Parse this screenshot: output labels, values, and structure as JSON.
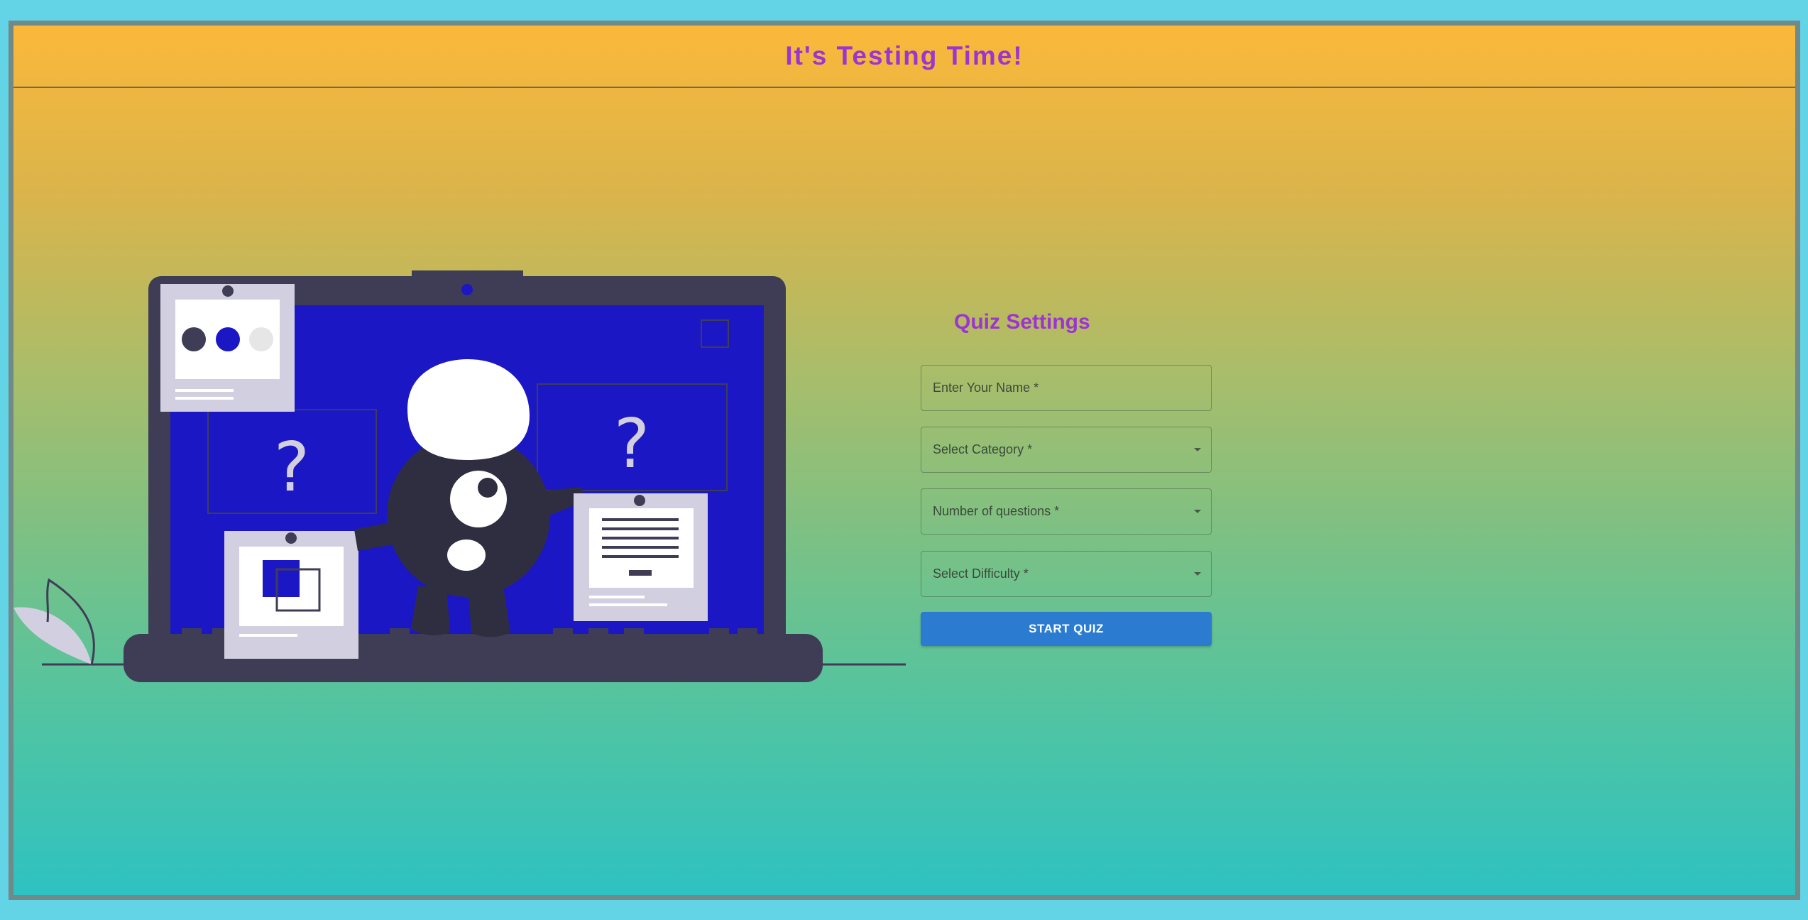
{
  "header": {
    "title": "It's Testing Time!"
  },
  "form": {
    "title": "Quiz Settings",
    "name_placeholder": "Enter Your Name *",
    "category_label": "Select Category *",
    "questions_label": "Number of questions *",
    "difficulty_label": "Select Difficulty *",
    "start_label": "START QUIZ"
  },
  "illustration": {
    "question_mark_left": "?",
    "question_mark_right": "?"
  },
  "colors": {
    "title": "#9b35d0",
    "button": "#2b7bd1",
    "screen": "#1c17c4",
    "laptop": "#3f3d56"
  }
}
